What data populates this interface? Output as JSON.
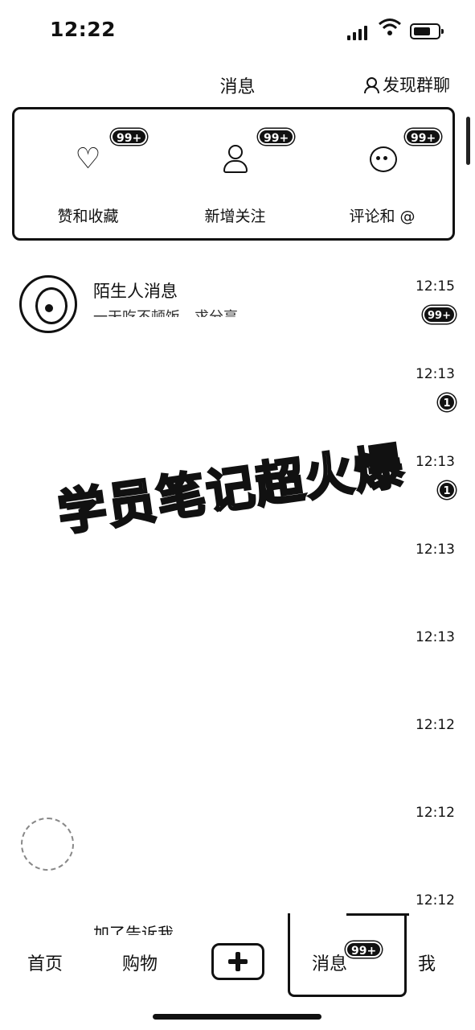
{
  "status_bar": {
    "time": "12:22"
  },
  "header": {
    "title": "消息",
    "discover_label": "发现群聊"
  },
  "actions": [
    {
      "label": "赞和收藏",
      "badge": "99+"
    },
    {
      "label": "新增关注",
      "badge": "99+"
    },
    {
      "label": "评论和 @",
      "badge": "99+"
    }
  ],
  "messages": [
    {
      "name": "陌生人消息",
      "preview": "一天吃不顿饭，求分享",
      "time": "12:15",
      "badge": "99+"
    },
    {
      "name": "",
      "preview": "",
      "time": "12:13",
      "badge": "1"
    },
    {
      "name": "",
      "preview": "",
      "time": "12:13",
      "badge": "1"
    },
    {
      "name": "",
      "preview": "",
      "time": "12:13",
      "badge": ""
    },
    {
      "name": "",
      "preview": "",
      "time": "12:13",
      "badge": ""
    },
    {
      "name": "",
      "preview": "",
      "time": "12:12",
      "badge": ""
    },
    {
      "name": "",
      "preview": "",
      "time": "12:12",
      "badge": ""
    },
    {
      "name": "",
      "preview": "加了告诉我",
      "time": "12:12",
      "badge": ""
    }
  ],
  "watermark": "学员笔记超火爆",
  "nav": {
    "home": "首页",
    "shop": "购物",
    "messages": "消息",
    "messages_badge": "99+",
    "me": "我"
  }
}
